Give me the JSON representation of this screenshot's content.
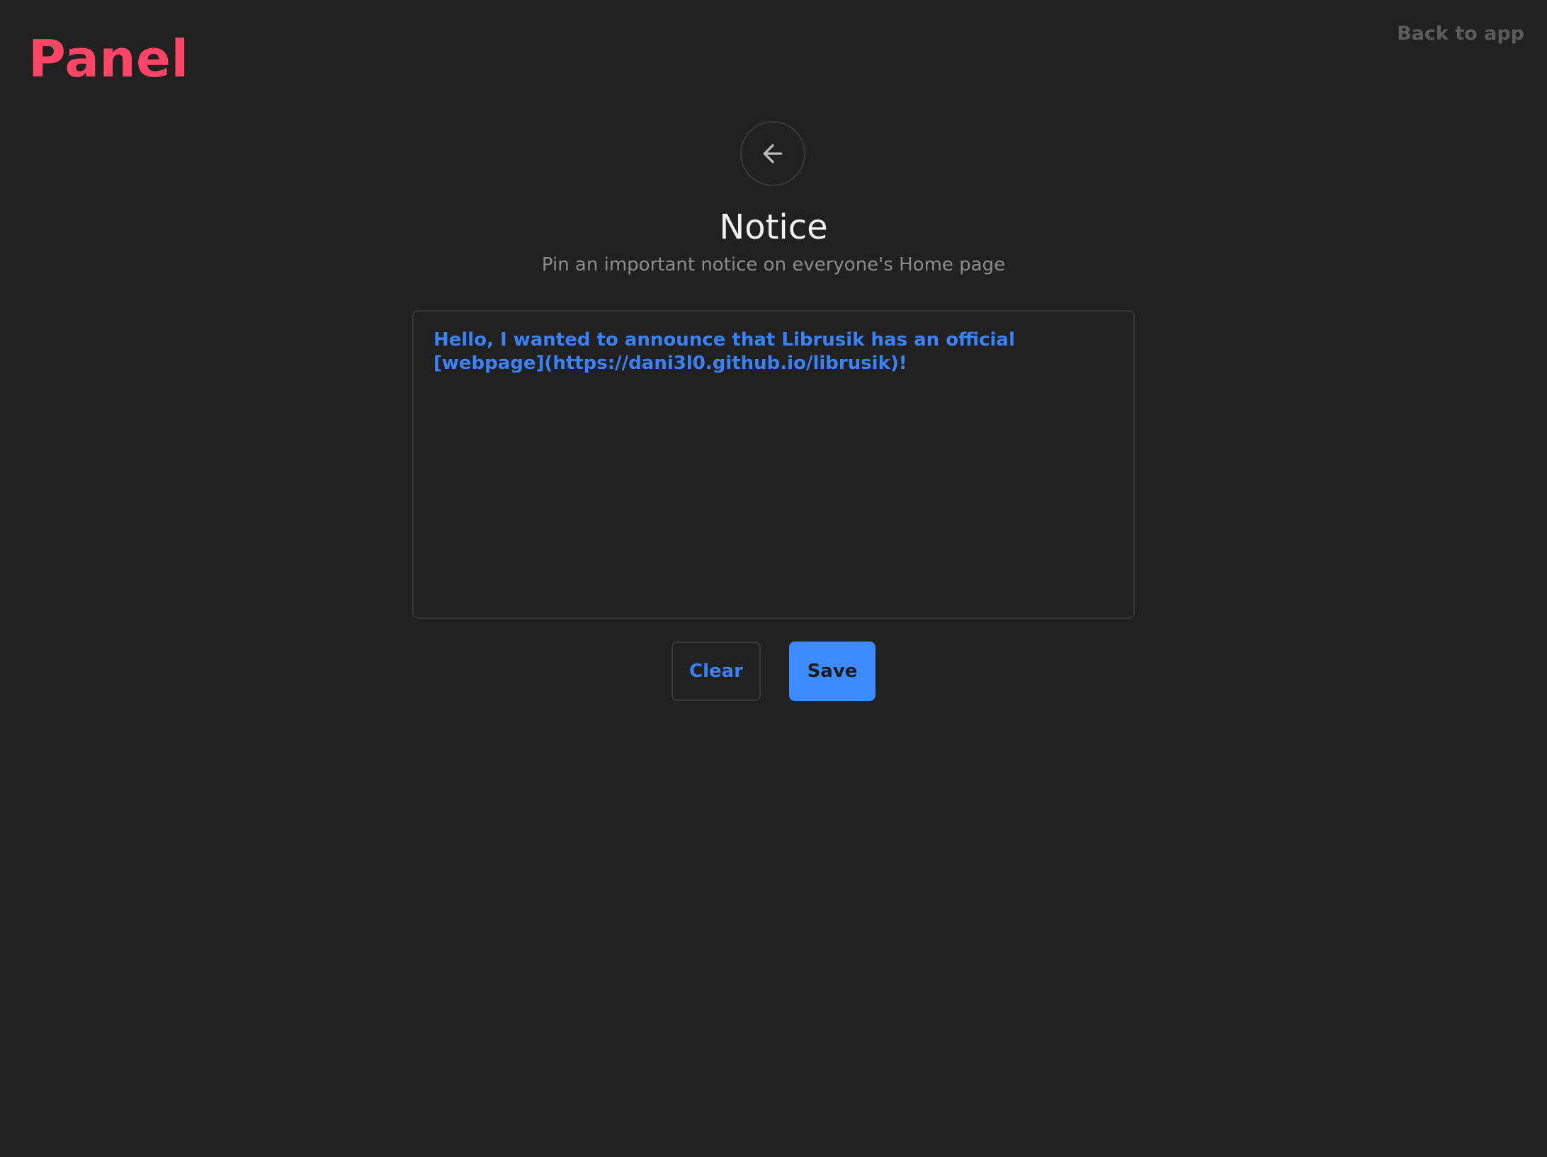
{
  "header": {
    "logo": "Panel",
    "back_to_app": "Back to app"
  },
  "page": {
    "back_icon": "arrow-left-icon",
    "title": "Notice",
    "subtitle": "Pin an important notice on everyone's Home page"
  },
  "notice": {
    "value": "Hello, I wanted to announce that Librusik has an official\n[webpage](https://dani3l0.github.io/librusik)!"
  },
  "actions": {
    "clear_label": "Clear",
    "save_label": "Save"
  },
  "colors": {
    "background": "#212121",
    "brand": "#ff4566",
    "accent": "#3d8bff",
    "text_blue": "#3b82f6",
    "muted": "#8c8c8c"
  }
}
